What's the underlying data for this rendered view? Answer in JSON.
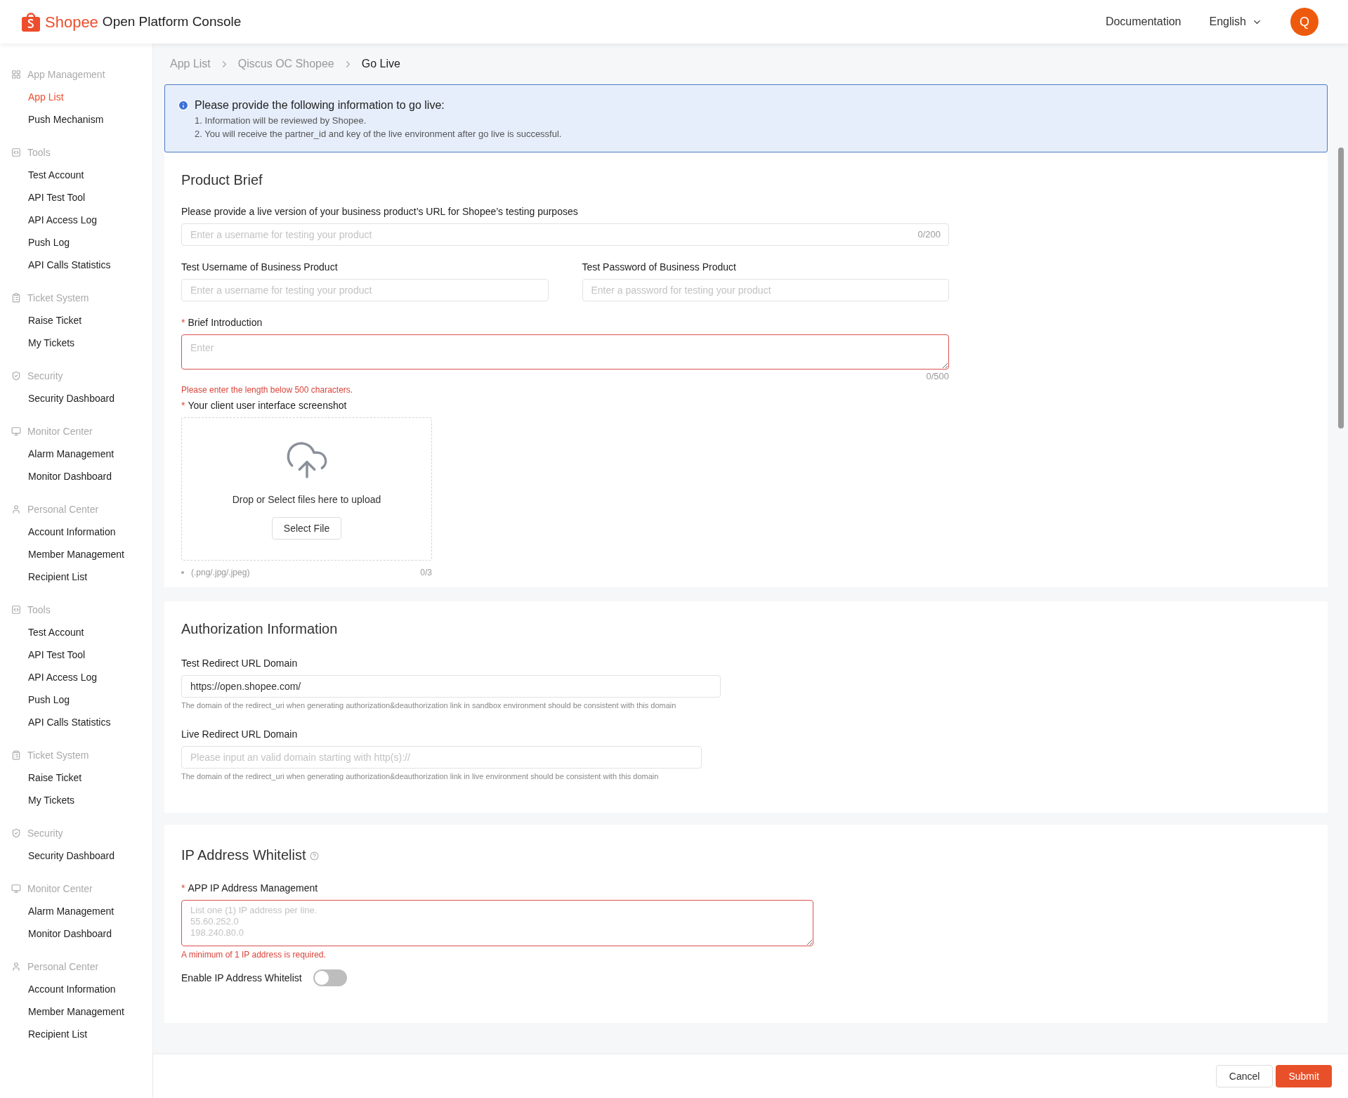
{
  "header": {
    "brand": "Shopee",
    "title": "Open Platform Console",
    "link": "Documentation",
    "language": "English",
    "avatar": "Q"
  },
  "sidebar": {
    "groups": [
      {
        "kind": "apps",
        "title": "App Management",
        "items": [
          {
            "label": "App List",
            "selected": true
          },
          {
            "label": "Push Mechanism",
            "selected": false
          }
        ]
      },
      {
        "kind": "tools",
        "title": "Tools",
        "items": [
          {
            "label": "Test Account",
            "selected": false
          },
          {
            "label": "API Test Tool",
            "selected": false
          },
          {
            "label": "API Access Log",
            "selected": false
          },
          {
            "label": "Push Log",
            "selected": false
          },
          {
            "label": "API Calls Statistics",
            "selected": false
          }
        ]
      },
      {
        "kind": "tickets",
        "title": "Ticket System",
        "items": [
          {
            "label": "Raise Ticket",
            "selected": false
          },
          {
            "label": "My Tickets",
            "selected": false
          }
        ]
      },
      {
        "kind": "security",
        "title": "Security",
        "items": [
          {
            "label": "Security Dashboard",
            "selected": false
          }
        ]
      },
      {
        "kind": "monitor",
        "title": "Monitor Center",
        "items": [
          {
            "label": "Alarm Management",
            "selected": false
          },
          {
            "label": "Monitor Dashboard",
            "selected": false
          }
        ]
      },
      {
        "kind": "personal",
        "title": "Personal Center",
        "items": [
          {
            "label": "Account Information",
            "selected": false
          },
          {
            "label": "Member Management",
            "selected": false
          },
          {
            "label": "Recipient List",
            "selected": false
          }
        ]
      },
      {
        "kind": "tools",
        "title": "Tools",
        "items": [
          {
            "label": "Test Account",
            "selected": false
          },
          {
            "label": "API Test Tool",
            "selected": false
          },
          {
            "label": "API Access Log",
            "selected": false
          },
          {
            "label": "Push Log",
            "selected": false
          },
          {
            "label": "API Calls Statistics",
            "selected": false
          }
        ]
      },
      {
        "kind": "tickets",
        "title": "Ticket System",
        "items": [
          {
            "label": "Raise Ticket",
            "selected": false
          },
          {
            "label": "My Tickets",
            "selected": false
          }
        ]
      },
      {
        "kind": "security",
        "title": "Security",
        "items": [
          {
            "label": "Security Dashboard",
            "selected": false
          }
        ]
      },
      {
        "kind": "monitor",
        "title": "Monitor Center",
        "items": [
          {
            "label": "Alarm Management",
            "selected": false
          },
          {
            "label": "Monitor Dashboard",
            "selected": false
          }
        ]
      },
      {
        "kind": "personal",
        "title": "Personal Center",
        "items": [
          {
            "label": "Account Information",
            "selected": false
          },
          {
            "label": "Member Management",
            "selected": false
          },
          {
            "label": "Recipient List",
            "selected": false
          }
        ]
      }
    ]
  },
  "breadcrumb": [
    "App List",
    "Qiscus OC Shopee",
    "Go Live"
  ],
  "notice": {
    "title": "Please provide the following information to go live:",
    "lines": [
      "1. Information will be reviewed by Shopee.",
      "2. You will receive the partner_id and key of the live environment after go live is successful."
    ]
  },
  "product_brief": {
    "title": "Product Brief",
    "url_field": {
      "label": "Please provide a live version of your business product’s URL for Shopee’s testing purposes",
      "placeholder": "Enter a username for testing your product",
      "counter": "0/200"
    },
    "username_field": {
      "label": "Test Username of Business Product",
      "placeholder": "Enter a username for testing your product"
    },
    "password_field": {
      "label": "Test Password of Business Product",
      "placeholder": "Enter a password for testing your product"
    },
    "intro_field": {
      "label": "Brief Introduction",
      "required_mark": "*",
      "placeholder": "Enter",
      "counter": "0/500",
      "error": "Please enter the length below 500 characters."
    },
    "screenshot": {
      "label": "Your client user interface screenshot",
      "required_mark": "*",
      "hint": "Drop or Select files here to upload",
      "button": "Select File",
      "formats": "(.png/.jpg/.jpeg)",
      "counter": "0/3"
    }
  },
  "authorization": {
    "title": "Authorization Information",
    "test_domain": {
      "label": "Test Redirect URL Domain",
      "value": "https://open.shopee.com/",
      "help": "The domain of the redirect_uri when generating authorization&deauthorization link in sandbox environment should be consistent with this domain"
    },
    "live_domain": {
      "label": "Live Redirect URL Domain",
      "placeholder": "Please input an valid domain starting with http(s)://",
      "help": "The domain of the redirect_uri when generating authorization&deauthorization link in live environment should be consistent with this domain"
    }
  },
  "ip_whitelist": {
    "title": "IP Address Whitelist",
    "ip_field": {
      "label": "APP IP Address Management",
      "required_mark": "*",
      "placeholder": "List one (1) IP address per line.\n55.60.252.0\n198.240.80.0",
      "error": "A minimum of 1 IP address is required."
    },
    "toggle": {
      "label": "Enable IP Address Whitelist",
      "on": false
    }
  },
  "footer": {
    "cancel": "Cancel",
    "submit": "Submit"
  }
}
